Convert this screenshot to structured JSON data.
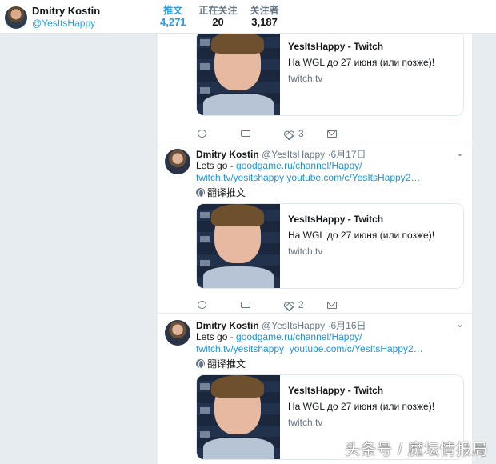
{
  "profile": {
    "name": "Dmitry Kostin",
    "handle": "@YesItsHappy"
  },
  "stats": [
    {
      "label": "推文",
      "value": "4,271",
      "active": true
    },
    {
      "label": "正在关注",
      "value": "20",
      "active": false
    },
    {
      "label": "关注者",
      "value": "3,187",
      "active": false
    }
  ],
  "card": {
    "title": "YesItsHappy - Twitch",
    "description": "На WGL до 27 июня (или позже)!",
    "domain": "twitch.tv"
  },
  "tweets": [
    {
      "likes": "3"
    },
    {
      "name": "Dmitry Kostin",
      "handle": "@YesItsHappy",
      "dot": "·",
      "date": "6月17日",
      "text_prefix": "Lets go - ",
      "link1": "goodgame.ru/channel/Happy/",
      "link2": "twitch.tv/yesitshappy",
      "link3": "youtube.com/c/YesItsHappy2…",
      "translate": "翻译推文",
      "likes": "2"
    },
    {
      "name": "Dmitry Kostin",
      "handle": "@YesItsHappy",
      "dot": "·",
      "date": "6月16日",
      "text_prefix": "Lets go - ",
      "link1": "goodgame.ru/channel/Happy/",
      "link2": "twitch.tv/yesitshappy",
      "link3": "youtube.com/c/YesItsHappy2…",
      "translate": "翻译推文"
    }
  ],
  "icons": {
    "reply": "reply-icon",
    "retweet": "retweet-icon",
    "like": "like-icon",
    "dm": "direct-message-icon",
    "caret": "chevron-down-icon",
    "globe": "globe-icon"
  },
  "caret": "⌄",
  "watermark": "头条号 / 魔坛情报局",
  "colors": {
    "accent": "#1da1f2",
    "link": "#1b95e0",
    "muted": "#657786",
    "background": "#e6ecf0"
  }
}
